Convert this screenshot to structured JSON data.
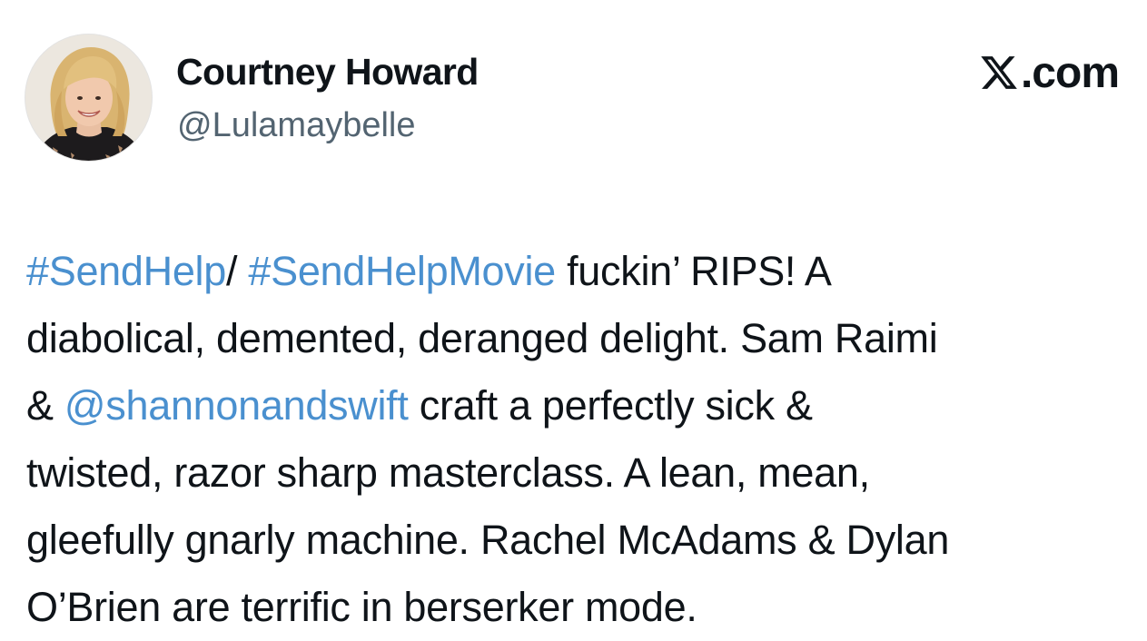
{
  "author": {
    "name": "Courtney Howard",
    "handle": "@Lulamaybelle",
    "avatar_icon": "profile-photo"
  },
  "brand": {
    "icon": "x-logo-icon",
    "suffix": ".com"
  },
  "colors": {
    "link": "#4a90cf",
    "text": "#0f1419",
    "handle": "#536471",
    "background": "#ffffff"
  },
  "tweet": {
    "lines": [
      [
        {
          "text": "#SendHelp",
          "type": "hashtag"
        },
        {
          "text": "/ ",
          "type": "text"
        },
        {
          "text": "#SendHelpMovie",
          "type": "hashtag"
        },
        {
          "text": " fuckin’ RIPS! A",
          "type": "text"
        }
      ],
      [
        {
          "text": "diabolical, demented, deranged delight. Sam Raimi",
          "type": "text"
        }
      ],
      [
        {
          "text": "& ",
          "type": "text"
        },
        {
          "text": "@shannonandswift",
          "type": "mention"
        },
        {
          "text": " craft a perfectly sick &",
          "type": "text"
        }
      ],
      [
        {
          "text": "twisted, razor sharp masterclass. A lean, mean,",
          "type": "text"
        }
      ],
      [
        {
          "text": "gleefully gnarly machine. Rachel McAdams & Dylan",
          "type": "text"
        }
      ],
      [
        {
          "text": "O’Brien are terrific in berserker mode.",
          "type": "text"
        }
      ]
    ]
  }
}
